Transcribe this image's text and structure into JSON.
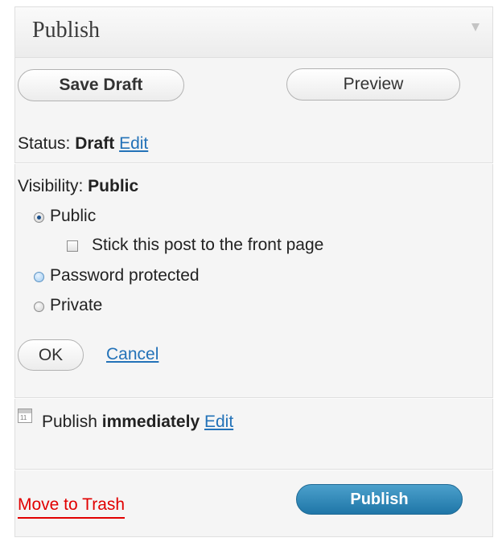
{
  "header": {
    "title": "Publish"
  },
  "actions": {
    "save_draft": "Save Draft",
    "preview": "Preview"
  },
  "status": {
    "label": "Status:",
    "value": "Draft",
    "edit": "Edit"
  },
  "visibility": {
    "label": "Visibility:",
    "value": "Public",
    "options": [
      {
        "label": "Public",
        "selected": true
      },
      {
        "label": "Password protected",
        "selected": false
      },
      {
        "label": "Private",
        "selected": false
      }
    ],
    "sticky_label": "Stick this post to the front page",
    "sticky_checked": false,
    "ok": "OK",
    "cancel": "Cancel"
  },
  "schedule": {
    "label": "Publish",
    "value": "immediately",
    "edit": "Edit"
  },
  "footer": {
    "trash": "Move to Trash",
    "publish": "Publish"
  },
  "icons": {
    "collapse": "triangle-down-icon",
    "calendar": "calendar-icon",
    "calendar_day": "11"
  },
  "colors": {
    "link": "#2372b8",
    "trash": "#e10000",
    "publish_button": "#2a84b8"
  }
}
